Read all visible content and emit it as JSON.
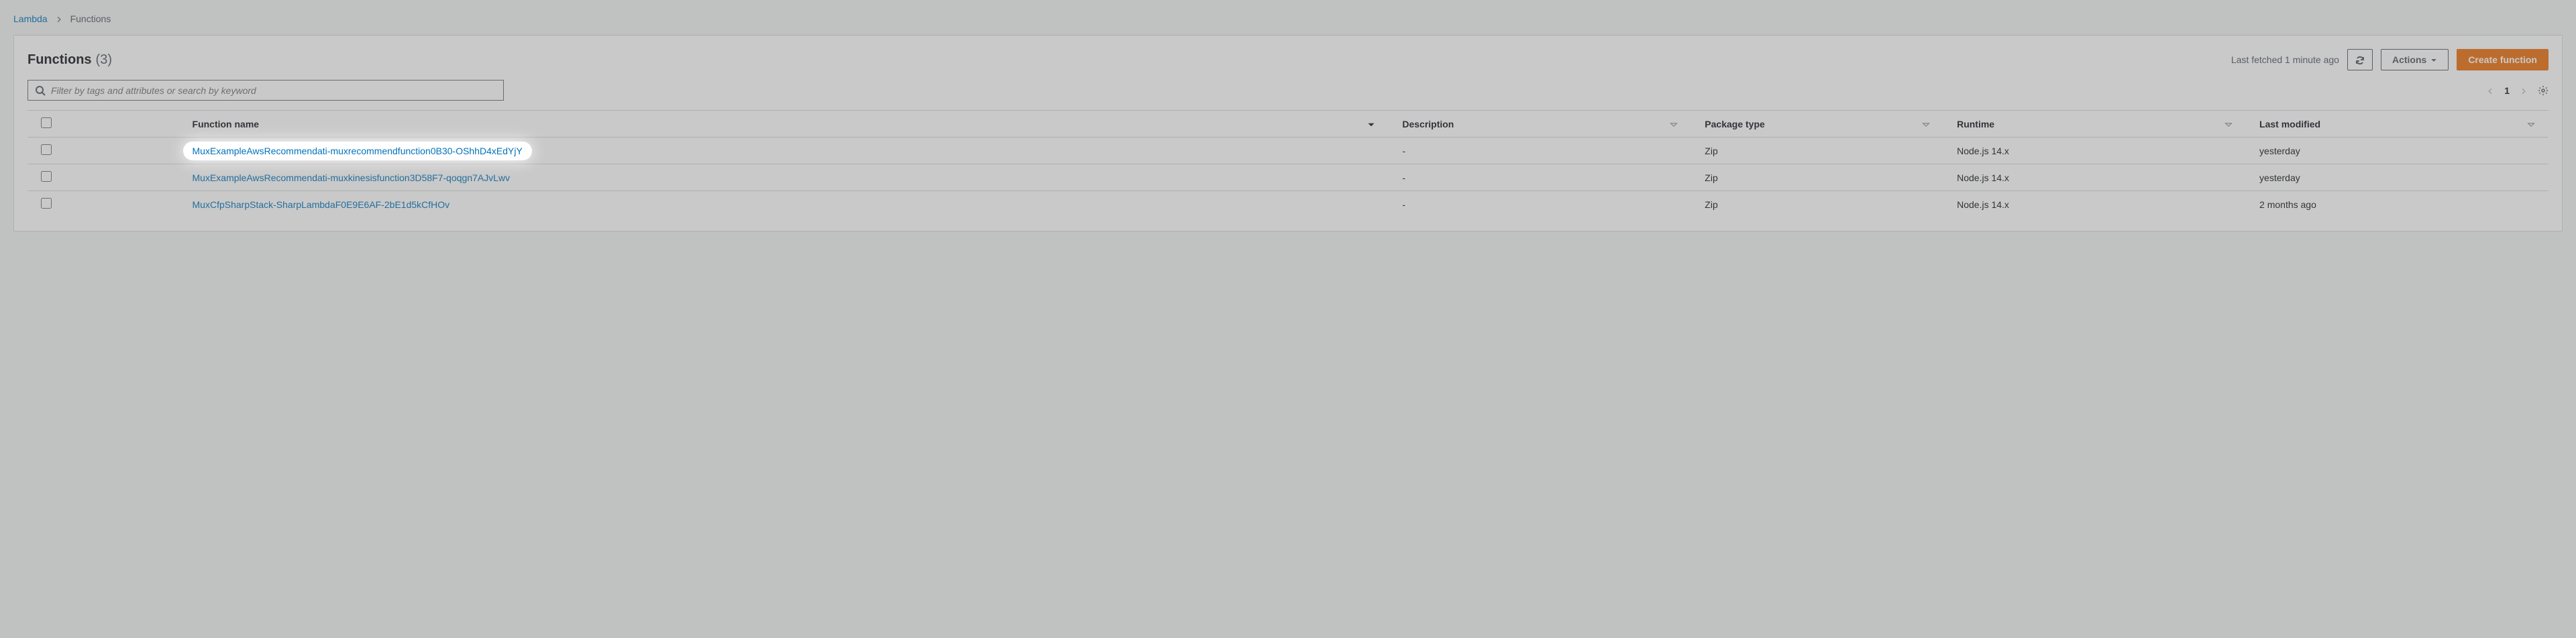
{
  "breadcrumb": {
    "root": "Lambda",
    "current": "Functions"
  },
  "header": {
    "title": "Functions",
    "count": "(3)",
    "last_fetched": "Last fetched 1 minute ago",
    "actions_label": "Actions",
    "create_label": "Create function"
  },
  "search": {
    "placeholder": "Filter by tags and attributes or search by keyword"
  },
  "pagination": {
    "page": "1"
  },
  "columns": {
    "name": "Function name",
    "description": "Description",
    "package": "Package type",
    "runtime": "Runtime",
    "modified": "Last modified"
  },
  "rows": [
    {
      "name": "MuxExampleAwsRecommendati-muxrecommendfunction0B30-OShhD4xEdYjY",
      "description": "-",
      "package": "Zip",
      "runtime": "Node.js 14.x",
      "modified": "yesterday",
      "highlighted": true
    },
    {
      "name": "MuxExampleAwsRecommendati-muxkinesisfunction3D58F7-qoqgn7AJvLwv",
      "description": "-",
      "package": "Zip",
      "runtime": "Node.js 14.x",
      "modified": "yesterday",
      "highlighted": false
    },
    {
      "name": "MuxCfpSharpStack-SharpLambdaF0E9E6AF-2bE1d5kCfHOv",
      "description": "-",
      "package": "Zip",
      "runtime": "Node.js 14.x",
      "modified": "2 months ago",
      "highlighted": false
    }
  ]
}
